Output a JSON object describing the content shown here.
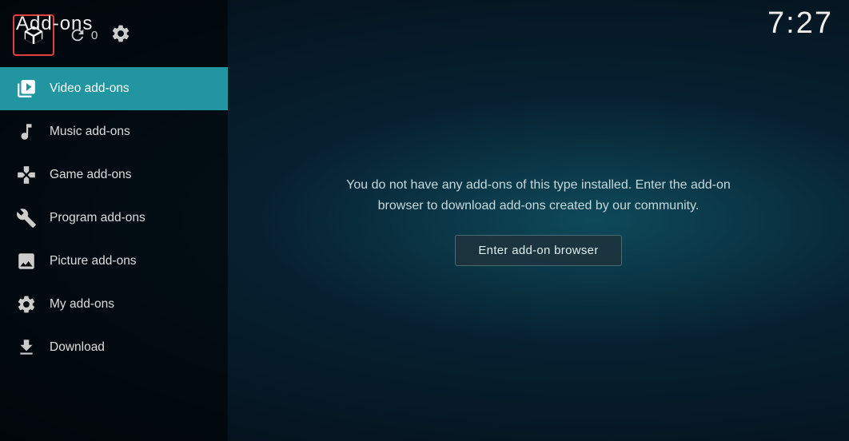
{
  "app": {
    "title": "Add-ons",
    "clock": "7:27"
  },
  "sidebar": {
    "header": {
      "addon_icon_label": "addon-box",
      "refresh_count": "0",
      "settings_label": "settings"
    },
    "nav_items": [
      {
        "id": "video",
        "label": "Video add-ons",
        "icon": "video",
        "active": true
      },
      {
        "id": "music",
        "label": "Music add-ons",
        "icon": "music",
        "active": false
      },
      {
        "id": "game",
        "label": "Game add-ons",
        "icon": "game",
        "active": false
      },
      {
        "id": "program",
        "label": "Program add-ons",
        "icon": "program",
        "active": false
      },
      {
        "id": "picture",
        "label": "Picture add-ons",
        "icon": "picture",
        "active": false
      },
      {
        "id": "myaddon",
        "label": "My add-ons",
        "icon": "myaddon",
        "active": false
      },
      {
        "id": "download",
        "label": "Download",
        "icon": "download",
        "active": false
      }
    ]
  },
  "main": {
    "empty_message": "You do not have any add-ons of this type installed. Enter the add-on browser to download add-ons created by our community.",
    "enter_browser_label": "Enter add-on browser"
  }
}
